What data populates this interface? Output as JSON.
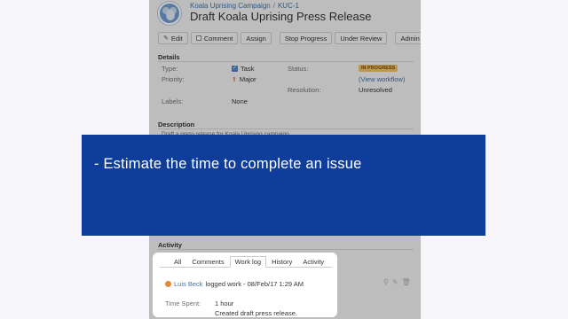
{
  "issue": {
    "breadcrumb": {
      "project": "Koala Uprising Campaign",
      "separator": "/",
      "key": "KUC-1"
    },
    "title": "Draft Koala Uprising Press Release"
  },
  "toolbar": {
    "edit": "Edit",
    "comment": "Comment",
    "assign": "Assign",
    "stop_progress": "Stop Progress",
    "under_review": "Under Review",
    "admin": "Admin"
  },
  "details": {
    "heading": "Details",
    "type_label": "Type:",
    "type_value": "Task",
    "priority_label": "Priority:",
    "priority_value": "Major",
    "labels_label": "Labels:",
    "labels_value": "None",
    "status_label": "Status:",
    "status_value": "IN PROGRESS",
    "workflow_link": "(View workflow)",
    "resolution_label": "Resolution:",
    "resolution_value": "Unresolved"
  },
  "description": {
    "heading": "Description",
    "text": "Draft a press release for Koala Uprising campaign."
  },
  "overlay": {
    "text": "- Estimate the time to complete an issue"
  },
  "activity": {
    "heading": "Activity",
    "tabs": [
      "All",
      "Comments",
      "Work log",
      "History",
      "Activity"
    ],
    "active_tab": "Work log",
    "entry": {
      "user": "Luis Beck",
      "action": "logged work - 08/Feb/17 1:29 AM",
      "time_spent_label": "Time Spent:",
      "time_spent_value": "1 hour",
      "comment": "Created draft press release."
    }
  },
  "colors": {
    "overlay_blue": "#0e3d9c",
    "link_blue": "#3b73af",
    "status_badge": "#f3c06a"
  }
}
